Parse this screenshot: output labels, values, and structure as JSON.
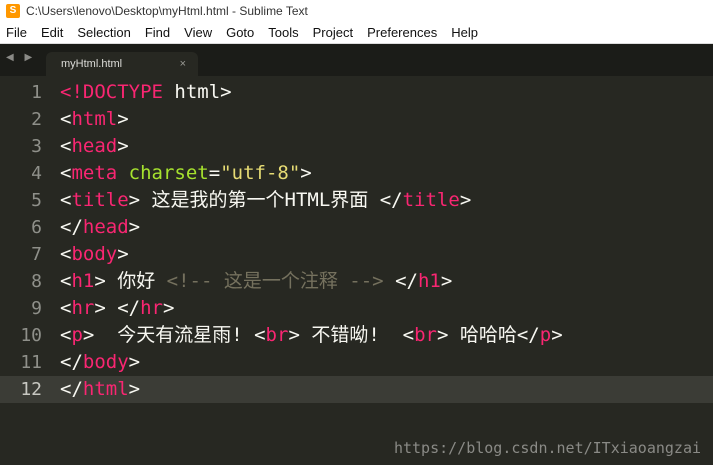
{
  "window": {
    "title": "C:\\Users\\lenovo\\Desktop\\myHtml.html - Sublime Text",
    "icon": "sublime-text-icon"
  },
  "menu": [
    "File",
    "Edit",
    "Selection",
    "Find",
    "View",
    "Goto",
    "Tools",
    "Project",
    "Preferences",
    "Help"
  ],
  "tabs": [
    {
      "label": "myHtml.html",
      "close": "×"
    }
  ],
  "tab_nav": "◀ ▶",
  "editor": {
    "current_line": 12,
    "lines": [
      {
        "num": "1",
        "tokens": [
          [
            "tag",
            "<!DOCTYPE"
          ],
          [
            "txt",
            " html>"
          ]
        ]
      },
      {
        "num": "2",
        "tokens": [
          [
            "txt",
            "<"
          ],
          [
            "tag",
            "html"
          ],
          [
            "txt",
            ">"
          ]
        ]
      },
      {
        "num": "3",
        "tokens": [
          [
            "txt",
            "<"
          ],
          [
            "tag",
            "head"
          ],
          [
            "txt",
            ">"
          ]
        ]
      },
      {
        "num": "4",
        "tokens": [
          [
            "txt",
            "<"
          ],
          [
            "tag",
            "meta"
          ],
          [
            "txt",
            " "
          ],
          [
            "attr",
            "charset"
          ],
          [
            "txt",
            "="
          ],
          [
            "str",
            "\"utf-8\""
          ],
          [
            "txt",
            ">"
          ]
        ]
      },
      {
        "num": "5",
        "tokens": [
          [
            "txt",
            "<"
          ],
          [
            "tag",
            "title"
          ],
          [
            "txt",
            "> 这是我的第一个HTML界面 </"
          ],
          [
            "tag",
            "title"
          ],
          [
            "txt",
            ">"
          ]
        ]
      },
      {
        "num": "6",
        "tokens": [
          [
            "txt",
            "</"
          ],
          [
            "tag",
            "head"
          ],
          [
            "txt",
            ">"
          ]
        ]
      },
      {
        "num": "7",
        "tokens": [
          [
            "txt",
            "<"
          ],
          [
            "tag",
            "body"
          ],
          [
            "txt",
            ">"
          ]
        ]
      },
      {
        "num": "8",
        "tokens": [
          [
            "txt",
            "<"
          ],
          [
            "tag",
            "h1"
          ],
          [
            "txt",
            "> 你好 "
          ],
          [
            "cmt",
            "<!-- 这是一个注释 -->"
          ],
          [
            "txt",
            " </"
          ],
          [
            "tag",
            "h1"
          ],
          [
            "txt",
            ">"
          ]
        ]
      },
      {
        "num": "9",
        "tokens": [
          [
            "txt",
            "<"
          ],
          [
            "tag",
            "hr"
          ],
          [
            "txt",
            "> </"
          ],
          [
            "tag",
            "hr"
          ],
          [
            "txt",
            ">"
          ]
        ]
      },
      {
        "num": "10",
        "tokens": [
          [
            "txt",
            "<"
          ],
          [
            "tag",
            "p"
          ],
          [
            "txt",
            ">  今天有流星雨! <"
          ],
          [
            "tag",
            "br"
          ],
          [
            "txt",
            "> 不错呦!  <"
          ],
          [
            "tag",
            "br"
          ],
          [
            "txt",
            "> 哈哈哈</"
          ],
          [
            "tag",
            "p"
          ],
          [
            "txt",
            ">"
          ]
        ]
      },
      {
        "num": "11",
        "tokens": [
          [
            "txt",
            "</"
          ],
          [
            "tag",
            "body"
          ],
          [
            "txt",
            ">"
          ]
        ]
      },
      {
        "num": "12",
        "tokens": [
          [
            "txt",
            "</"
          ],
          [
            "tag",
            "html"
          ],
          [
            "txt",
            ">"
          ]
        ]
      }
    ]
  },
  "watermark": "https://blog.csdn.net/ITxiaoangzai",
  "colors": {
    "background": "#272822",
    "tag": "#f92672",
    "attribute": "#a6e22e",
    "string": "#e6db74",
    "comment": "#75715e",
    "text": "#f8f8f2",
    "line_number": "#8f908a"
  }
}
